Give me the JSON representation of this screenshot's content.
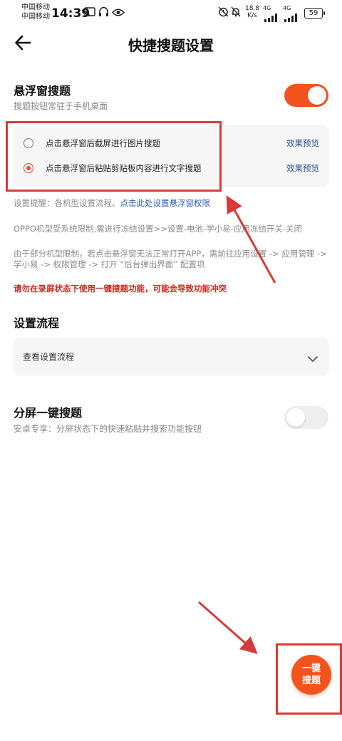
{
  "status_bar": {
    "carrier1": "中国移动",
    "carrier2": "中国移动",
    "time": "14:39",
    "speed_value": "18.8",
    "speed_unit": "K/s",
    "signal1": "4G",
    "signal2": "4G",
    "battery": "59"
  },
  "header": {
    "title": "快捷搜题设置"
  },
  "floating": {
    "title": "悬浮窗搜题",
    "subtitle": "搜题按钮常驻于手机桌面",
    "toggle_on": true,
    "options": [
      {
        "label": "点击悬浮窗后截屏进行图片搜题",
        "preview": "效果预览",
        "selected": false
      },
      {
        "label": "点击悬浮窗后粘贴剪贴板内容进行文字搜题",
        "preview": "效果预览",
        "selected": true
      }
    ]
  },
  "notes": {
    "reminder_prefix": "设置提醒：各机型设置流程。",
    "reminder_link": "点击此处设置悬浮窗权限",
    "oppo": "OPPO机型受系统限制,需进行冻结设置>>设置-电池-学小易-应用冻结开关-关闭",
    "limit_line1": "由于部分机型限制，若点击悬浮窗无法正常打开APP，需前往应用设置 -> 应用管理 ->",
    "limit_line2": "学小易 -> 权限管理 -> 打开 “后台弹出界面” 配置项",
    "warning": "请勿在录屏状态下使用一键搜题功能，可能会导致功能冲突"
  },
  "setup": {
    "title": "设置流程",
    "dropdown_label": "查看设置流程"
  },
  "split": {
    "title": "分屏一键搜题",
    "subtitle": "安卓专享：分屏状态下的快速粘贴并搜索功能按钮",
    "toggle_on": false
  },
  "fab": {
    "line1": "一键",
    "line2": "搜题"
  },
  "colors": {
    "accent": "#f3541e",
    "annotation": "#d83a3a",
    "link": "#2b5ab0",
    "warning": "#d0261c"
  }
}
